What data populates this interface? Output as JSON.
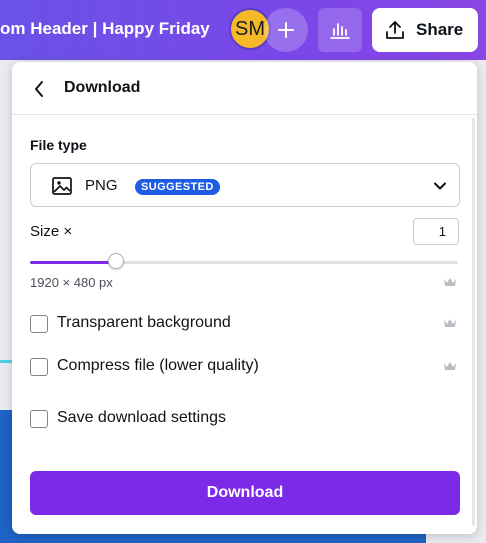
{
  "header": {
    "doc_title": "om Header | Happy Friday",
    "avatar_initials": "SM",
    "share_label": "Share"
  },
  "panel": {
    "title": "Download",
    "file_type": {
      "label": "File type",
      "value": "PNG",
      "badge": "SUGGESTED"
    },
    "size": {
      "label": "Size ×",
      "value": "1",
      "slider_level": 0.2,
      "dimensions": "1920 × 480 px"
    },
    "options": [
      {
        "label": "Transparent background",
        "checked": false,
        "pro": true
      },
      {
        "label": "Compress file (lower quality)",
        "checked": false,
        "pro": true
      },
      {
        "label": "Save download settings",
        "checked": false,
        "pro": false
      }
    ],
    "download_label": "Download"
  },
  "icons": {
    "back": "chevron-left-icon",
    "image": "image-icon",
    "dropdown": "chevron-down-icon",
    "pro": "crown-icon",
    "plus": "plus-icon",
    "insights": "bar-chart-icon",
    "share": "upload-icon"
  },
  "colors": {
    "header_gradient_start": "#6a52e6",
    "header_gradient_end": "#8a45e6",
    "accent": "#7d2ae8",
    "badge": "#1e5ce6",
    "avatar": "#f5b829"
  }
}
